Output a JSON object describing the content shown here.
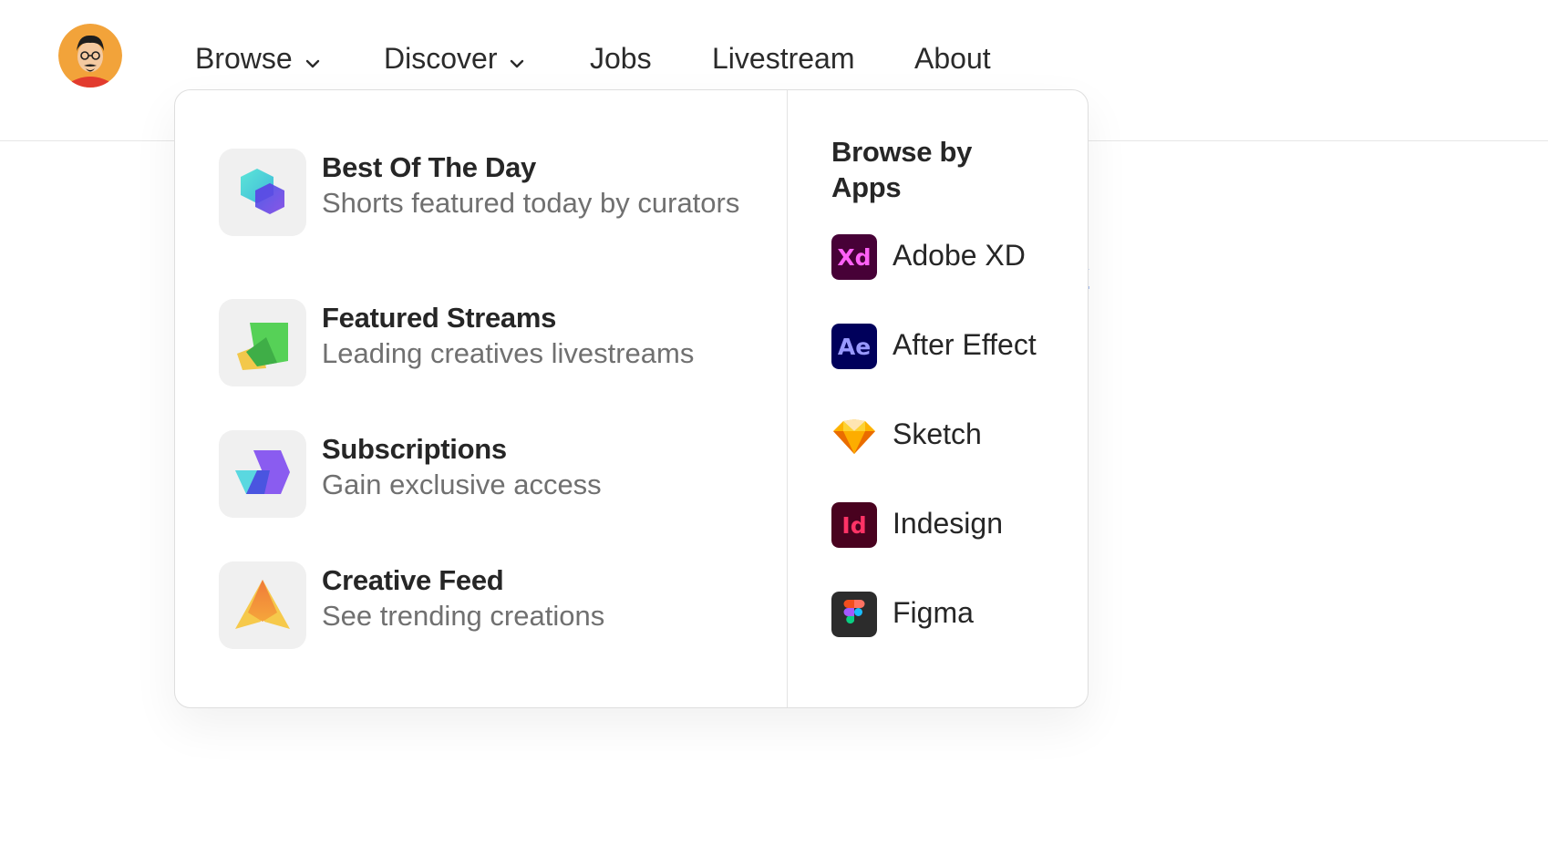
{
  "nav": {
    "items": [
      {
        "label": "Browse"
      },
      {
        "label": "Discover"
      },
      {
        "label": "Jobs"
      },
      {
        "label": "Livestream"
      },
      {
        "label": "About"
      }
    ]
  },
  "background": {
    "partial_link": "ory"
  },
  "dropdown": {
    "features": [
      {
        "title": "Best Of The Day",
        "description": "Shorts featured today by curators",
        "icon": "hexagon-cube-icon"
      },
      {
        "title": "Featured Streams",
        "description": "Leading creatives livestreams",
        "icon": "stream-cards-icon"
      },
      {
        "title": "Subscriptions",
        "description": "Gain exclusive access",
        "icon": "subscriptions-icon"
      },
      {
        "title": "Creative Feed",
        "description": "See trending creations",
        "icon": "triangle-feed-icon"
      }
    ],
    "apps_heading": "Browse by Apps",
    "apps": [
      {
        "label": "Adobe XD",
        "badge": "Xd",
        "icon": "adobe-xd-icon"
      },
      {
        "label": "After Effect",
        "badge": "Ae",
        "icon": "after-effects-icon"
      },
      {
        "label": "Sketch",
        "icon": "sketch-icon"
      },
      {
        "label": "Indesign",
        "badge": "Id",
        "icon": "indesign-icon"
      },
      {
        "label": "Figma",
        "icon": "figma-icon"
      }
    ]
  },
  "colors": {
    "link": "#3b6fe0",
    "xd_bg": "#470137",
    "xd_fg": "#ff61f6",
    "ae_bg": "#00005b",
    "ae_fg": "#9999ff",
    "id_bg": "#49021f",
    "id_fg": "#ff3366",
    "figma_bg": "#2c2c2c"
  }
}
